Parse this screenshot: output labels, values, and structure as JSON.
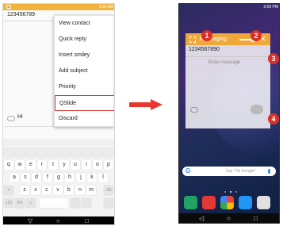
{
  "left_phone": {
    "status_time": "9:05 AM",
    "recipient": "123456789",
    "compose_text": "Hi",
    "menu_items": [
      "View contact",
      "Quick reply",
      "Insert smiley",
      "Add subject",
      "Priority",
      "QSlide",
      "Discard"
    ],
    "highlight_color": "#d9302a",
    "keyboard": {
      "row1": [
        "q",
        "w",
        "e",
        "r",
        "t",
        "y",
        "u",
        "i",
        "o",
        "p"
      ],
      "row2": [
        "a",
        "s",
        "d",
        "f",
        "g",
        "h",
        "j",
        "k",
        "l"
      ],
      "row3": [
        "z",
        "x",
        "c",
        "v",
        "b",
        "n",
        "m"
      ],
      "row4": [
        "123",
        "EN",
        "☺"
      ]
    },
    "nav_icons": [
      "back-triangle",
      "home-circle",
      "recents-square"
    ]
  },
  "arrow_color": "#e8382d",
  "right_phone": {
    "status_time": "2:09 PM",
    "qslide": {
      "title": "Messaging",
      "recipient": "1234567890",
      "placeholder": "Enter message",
      "title_color": "#f0a83a"
    },
    "badges": [
      "1",
      "2",
      "3",
      "4"
    ],
    "google_bar": {
      "logo": "G",
      "hint": "Say \"Ok Google\""
    },
    "dock_colors": [
      "#1fa463",
      "#e53935",
      "#f6a623",
      "#2196f3",
      "#e0e0e0"
    ]
  }
}
